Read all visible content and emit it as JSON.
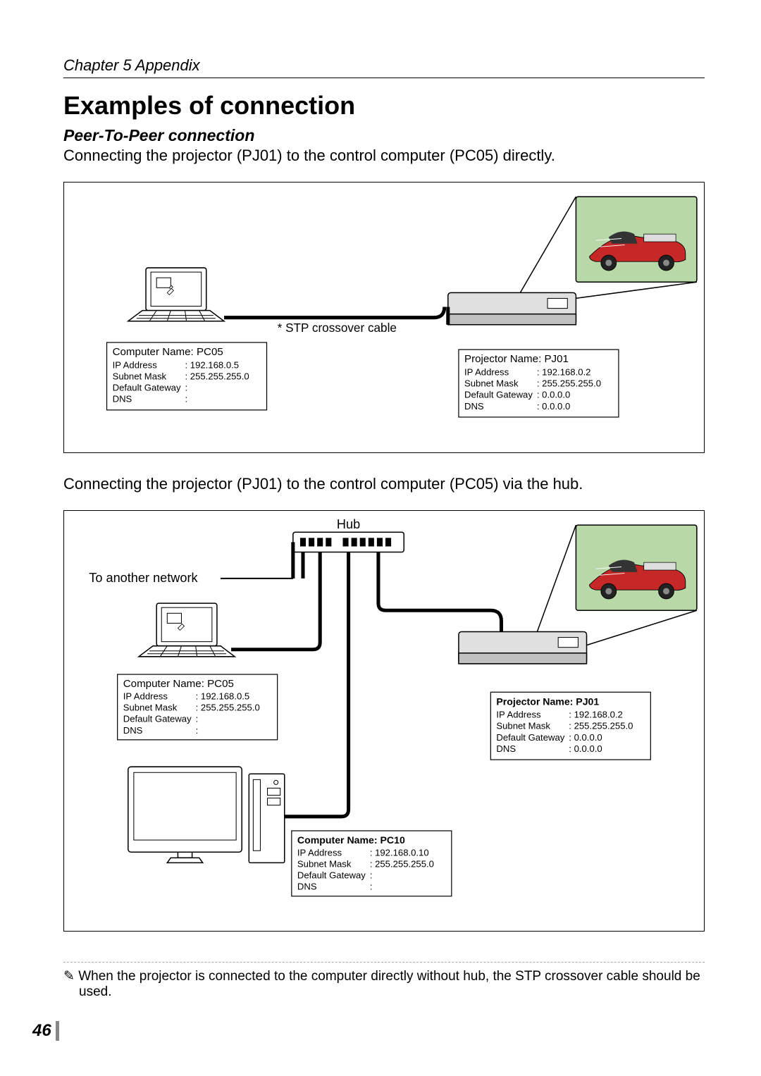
{
  "chapter": "Chapter 5 Appendix",
  "title": "Examples of connection",
  "subtitle": "Peer-To-Peer connection",
  "para1": "Connecting the projector (PJ01) to the control computer (PC05) directly.",
  "para2": "Connecting the projector (PJ01) to the control computer (PC05) via the hub.",
  "footnote": "✎ When the projector is connected to the computer directly without hub, the STP crossover cable should be used.",
  "pagenum": "46",
  "diagram1": {
    "cable_label": "* STP crossover cable",
    "computer": {
      "title": "Computer Name: PC05",
      "rows": [
        [
          "IP Address",
          ": 192.168.0.5"
        ],
        [
          "Subnet Mask",
          ": 255.255.255.0"
        ],
        [
          "Default Gateway",
          ":"
        ],
        [
          "DNS",
          ":"
        ]
      ]
    },
    "projector": {
      "title": "Projector Name: PJ01",
      "rows": [
        [
          "IP Address",
          ": 192.168.0.2"
        ],
        [
          "Subnet Mask",
          ": 255.255.255.0"
        ],
        [
          "Default Gateway",
          ": 0.0.0.0"
        ],
        [
          "DNS",
          ": 0.0.0.0"
        ]
      ]
    }
  },
  "diagram2": {
    "hub_label": "Hub",
    "to_network": "To another network",
    "computer1": {
      "title": "Computer Name: PC05",
      "rows": [
        [
          "IP Address",
          ": 192.168.0.5"
        ],
        [
          "Subnet Mask",
          ": 255.255.255.0"
        ],
        [
          "Default Gateway",
          ":"
        ],
        [
          "DNS",
          ":"
        ]
      ]
    },
    "projector": {
      "title": "Projector Name: PJ01",
      "rows": [
        [
          "IP Address",
          ": 192.168.0.2"
        ],
        [
          "Subnet Mask",
          ": 255.255.255.0"
        ],
        [
          "Default Gateway",
          ": 0.0.0.0"
        ],
        [
          "DNS",
          ": 0.0.0.0"
        ]
      ]
    },
    "computer2": {
      "title": "Computer Name: PC10",
      "rows": [
        [
          "IP Address",
          ": 192.168.0.10"
        ],
        [
          "Subnet Mask",
          ": 255.255.255.0"
        ],
        [
          "Default Gateway",
          ":"
        ],
        [
          "DNS",
          ":"
        ]
      ]
    }
  }
}
